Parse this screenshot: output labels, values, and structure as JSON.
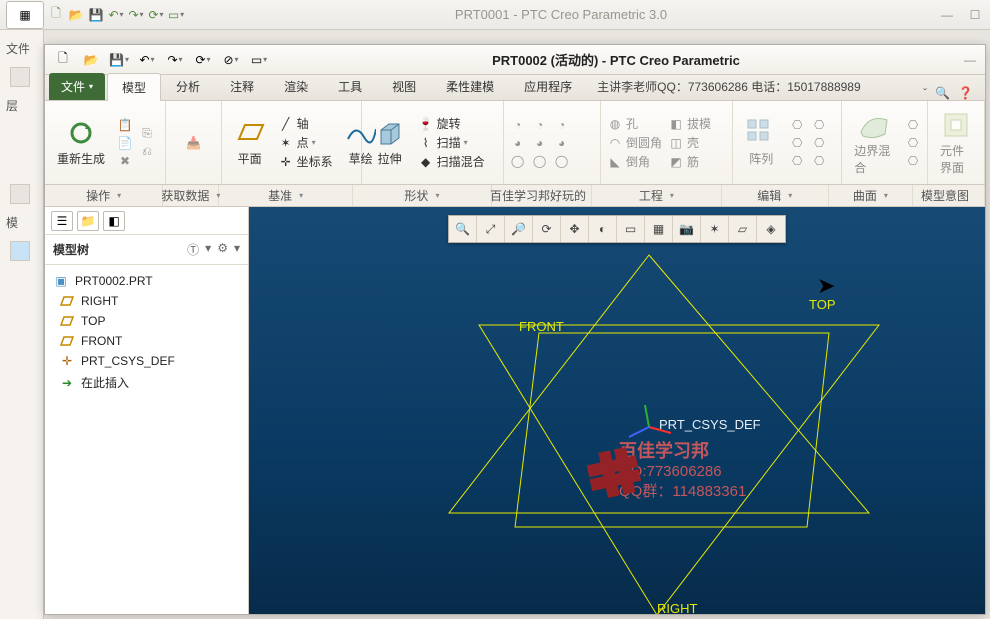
{
  "outer": {
    "title": "PRT0001 - PTC Creo Parametric 3.0",
    "file_tab": "文件",
    "layers_tab": "层",
    "models_tab": "模"
  },
  "inner": {
    "qa_icons": [
      "new",
      "open",
      "save",
      "undo",
      "redo",
      "regen",
      "close",
      "windows"
    ],
    "title": "PRT0002 (活动的) - PTC Creo Parametric",
    "tabs": {
      "file": "文件",
      "model": "模型",
      "analysis": "分析",
      "annotate": "注释",
      "render": "渲染",
      "tools": "工具",
      "view": "视图",
      "flex": "柔性建模",
      "apps": "应用程序"
    },
    "trail": "主讲李老师QQ：773606286  电话：15017888989"
  },
  "ribbon": {
    "regen": "重新生成",
    "plane": "平面",
    "axis": "轴",
    "point": "点",
    "csys": "坐标系",
    "sketch": "草绘",
    "extrude": "拉伸",
    "revolve": "旋转",
    "sweep": "扫描",
    "swept_blend": "扫描混合",
    "hole": "孔",
    "round": "倒圆角",
    "chamfer": "倒角",
    "draft": "拔模",
    "shell": "壳",
    "rib": "筋",
    "pattern": "阵列",
    "boundary": "边界混合",
    "component_ui": "元件界面",
    "actions": "操作",
    "get_data": "获取数据",
    "datum": "基准",
    "shapes": "形状",
    "bj_group": "百佳学习邦好玩的",
    "engineering": "工程",
    "edit": "编辑",
    "surface": "曲面",
    "model_intent": "模型意图"
  },
  "tree": {
    "title": "模型树",
    "root": "PRT0002.PRT",
    "items": [
      "RIGHT",
      "TOP",
      "FRONT",
      "PRT_CSYS_DEF",
      "在此插入"
    ]
  },
  "viewport": {
    "labels": {
      "top": "TOP",
      "front": "FRONT",
      "right": "RIGHT",
      "csys": "PRT_CSYS_DEF"
    },
    "watermark": {
      "line1": "百佳学习邦",
      "line2": "QQ:773606286",
      "line3": "QQ群：114883361"
    },
    "tools": [
      "zoom-in",
      "zoom-fit",
      "zoom-out",
      "refit",
      "pan",
      "spin",
      "saved-view",
      "view-mgr",
      "camera",
      "annot",
      "perspec",
      "style"
    ]
  }
}
